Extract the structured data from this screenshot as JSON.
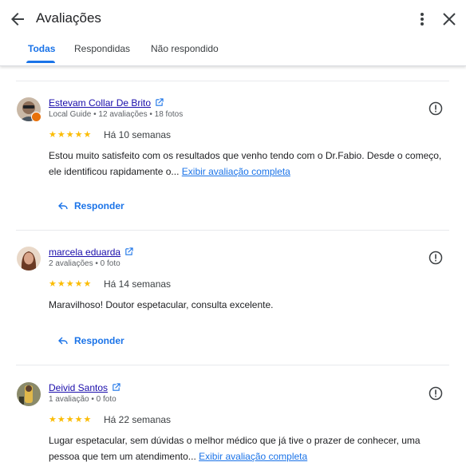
{
  "header": {
    "title": "Avaliações",
    "tabs": [
      "Todas",
      "Respondidas",
      "Não respondido"
    ]
  },
  "colors": {
    "accent": "#1a73e8",
    "star": "#fbbc04",
    "link": "#1a0dab",
    "badge": "#e8710a"
  },
  "reviews": [
    {
      "author": "Estevam Collar De Brito",
      "meta": "Local Guide • 12 avaliações • 18 fotos",
      "stars": "★★★★★",
      "time": "Há 10 semanas",
      "text": "Estou muito satisfeito com os resultados que venho tendo com o Dr.Fabio. Desde o começo, ele identificou rapidamente o...",
      "more": "Exibir avaliação completa",
      "reply": "Responder"
    },
    {
      "author": "marcela eduarda",
      "meta": "2 avaliações • 0 foto",
      "stars": "★★★★★",
      "time": "Há 14 semanas",
      "text": "Maravilhoso! Doutor espetacular, consulta excelente.",
      "reply": "Responder"
    },
    {
      "author": "Deivid Santos",
      "meta": "1 avaliação • 0 foto",
      "stars": "★★★★★",
      "time": "Há 22 semanas",
      "text": "Lugar espetacular, sem dúvidas o melhor médico que já tive o prazer de conhecer, uma pessoa que tem um atendimento...",
      "more": "Exibir avaliação completa"
    }
  ]
}
